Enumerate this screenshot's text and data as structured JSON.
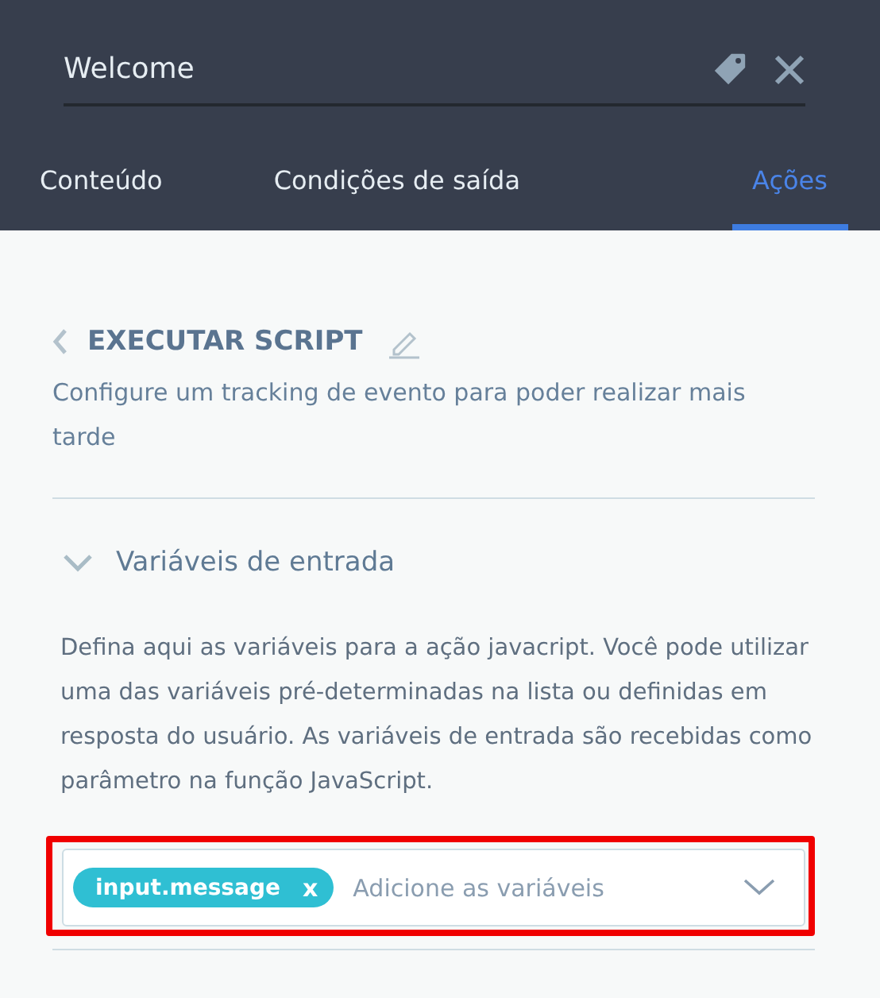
{
  "header": {
    "title": "Welcome"
  },
  "tabs": [
    {
      "label": "Conteúdo",
      "selected": false
    },
    {
      "label": "Condições de saída",
      "selected": false
    },
    {
      "label": "Ações",
      "selected": true
    }
  ],
  "action": {
    "title": "EXECUTAR SCRIPT",
    "description": "Configure um tracking de evento para poder realizar mais tarde"
  },
  "section": {
    "title": "Variáveis de entrada",
    "expanded": true,
    "description": "Defina aqui as variáveis para a ação javacript. Você pode utilizar uma das variáveis pré-determinadas na lista ou definidas em resposta do usuário. As variáveis de entrada são recebidas como parâmetro na função JavaScript.",
    "field": {
      "tags": [
        {
          "label": "input.message",
          "remove": "x"
        }
      ],
      "placeholder": "Adicione as variáveis",
      "highlighted": true
    }
  }
}
